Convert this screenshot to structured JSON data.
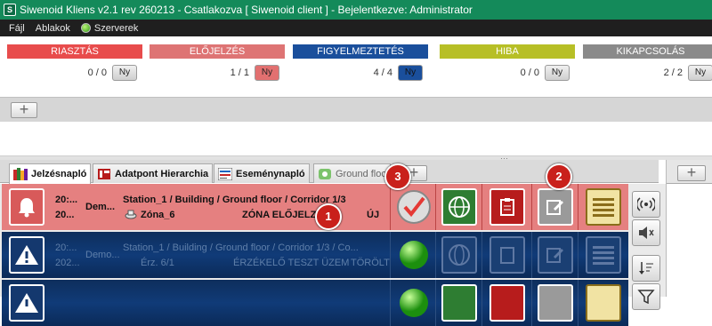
{
  "titlebar": {
    "title": "Siwenoid Kliens v2.1 rev 260213 - Csatlakozva [ Siwenoid client ] - Bejelentkezve: Administrator",
    "icon": "app-icon"
  },
  "menu": {
    "file": "Fájl",
    "windows": "Ablakok",
    "servers": "Szerverek"
  },
  "status": [
    {
      "label": "RIASZTÁS",
      "count": "0 / 0",
      "btn": "Ny",
      "color": "#e84c4c",
      "btncolor": "#d5d5d5"
    },
    {
      "label": "ELŐJELZÉS",
      "count": "1 / 1",
      "btn": "Ny",
      "color": "#de7474",
      "btncolor": "#e27070"
    },
    {
      "label": "FIGYELMEZTETÉS",
      "count": "4 / 4",
      "btn": "Ny",
      "color": "#1a4f9c",
      "btncolor": "#1a4f9c"
    },
    {
      "label": "HIBA",
      "count": "0 / 0",
      "btn": "Ny",
      "color": "#b7bf26",
      "btncolor": "#d5d5d5"
    },
    {
      "label": "KIKAPCSOLÁS",
      "count": "2 / 2",
      "btn": "Ny",
      "color": "#8a8a8a",
      "btncolor": "#d5d5d5"
    }
  ],
  "tabs": {
    "t1": "Jelzésnapló",
    "t2": "Adatpont Hierarchia",
    "t3": "Eseménynapló",
    "t4": "Ground floo"
  },
  "rows": [
    {
      "time1": "20:...",
      "time2": "20...",
      "who": "Dem...",
      "path": "Station_1 / Building / Ground floor / Corridor 1/3",
      "zone": "Zóna_6",
      "event": "ZÓNA ELŐJELZÉS",
      "state": "ÚJ"
    },
    {
      "time1": "20:...",
      "time2": "202...",
      "who": "Demo...",
      "path": "Station_1 / Building / Ground floor / Corridor 1/3 / Co...",
      "zone": "Érz. 6/1",
      "event": "ÉRZÉKELŐ TESZT ÜZEM",
      "state": "TÖRÖLT"
    }
  ],
  "badges": {
    "b1": "1",
    "b2": "2",
    "b3": "3"
  }
}
